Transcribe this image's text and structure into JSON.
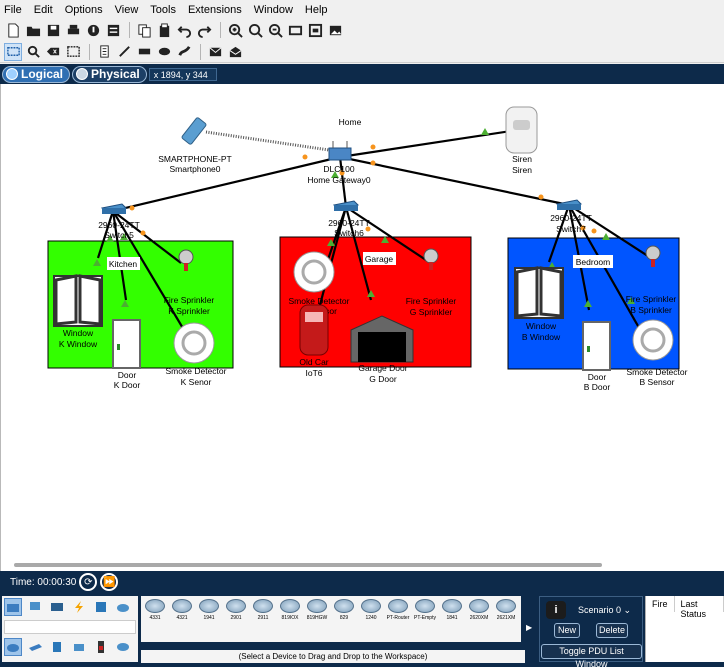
{
  "menu": [
    "File",
    "Edit",
    "Options",
    "View",
    "Tools",
    "Extensions",
    "Window",
    "Help"
  ],
  "view": {
    "logical": "Logical",
    "physical": "Physical",
    "coords": "x 1894, y 344"
  },
  "diagram": {
    "home_label": "Home",
    "smartphone_type": "SMARTPHONE-PT",
    "smartphone_name": "Smartphone0",
    "gateway_model": "DLC100",
    "gateway_name": "Home Gateway0",
    "siren_type": "Siren",
    "siren_name": "Siren",
    "switch_k_model": "2960-24TT",
    "switch_k_name": "Switch5",
    "switch_g_model": "2960-24TT",
    "switch_g_name": "Switch6",
    "switch_b_model": "2960-24TT",
    "switch_b_name": "Switch7",
    "rooms": {
      "kitchen": "Kitchen",
      "garage": "Garage",
      "bedroom": "Bedroom"
    },
    "kitchen_window_type": "Window",
    "kitchen_window_name": "K Window",
    "kitchen_door_type": "Door",
    "kitchen_door_name": "K Door",
    "kitchen_sprinkler_type": "Fire Sprinkler",
    "kitchen_sprinkler_name": "K Sprinkler",
    "kitchen_smoke_type": "Smoke Detector",
    "kitchen_smoke_name": "K Senor",
    "garage_smoke_type": "Smoke Detector",
    "garage_smoke_name": "G Sensor",
    "garage_sprinkler_type": "Fire Sprinkler",
    "garage_sprinkler_name": "G Sprinkler",
    "garage_car_type": "Old Car",
    "garage_car_name": "IoT6",
    "garage_door_type": "Garage Door",
    "garage_door_name": "G Door",
    "bedroom_window_type": "Window",
    "bedroom_window_name": "B Window",
    "bedroom_door_type": "Door",
    "bedroom_door_name": "B Door",
    "bedroom_sprinkler_type": "Fire Sprinkler",
    "bedroom_sprinkler_name": "B Sprinkler",
    "bedroom_smoke_type": "Smoke Detector",
    "bedroom_smoke_name": "B Sensor"
  },
  "time": {
    "label": "Time: 00:00:30"
  },
  "devices": [
    "4331",
    "4321",
    "1941",
    "2901",
    "2911",
    "819IOX",
    "819HGW",
    "829",
    "1240",
    "PT-Router",
    "PT-Empty",
    "1841",
    "2620XM",
    "2621XM"
  ],
  "device_hint": "(Select a Device to Drag and Drop to the Workspace)",
  "scenario": {
    "info": "i",
    "selected": "Scenario 0",
    "new": "New",
    "delete": "Delete",
    "toggle": "Toggle PDU List Window"
  },
  "pdu_columns": [
    "Fire",
    "Last Status"
  ],
  "colors": {
    "kitchen": "#33ff00",
    "garage": "#ff0000",
    "bedroom": "#0055ff",
    "link": "#000000",
    "port": "#f7941d",
    "navy": "#0d2a4a"
  }
}
